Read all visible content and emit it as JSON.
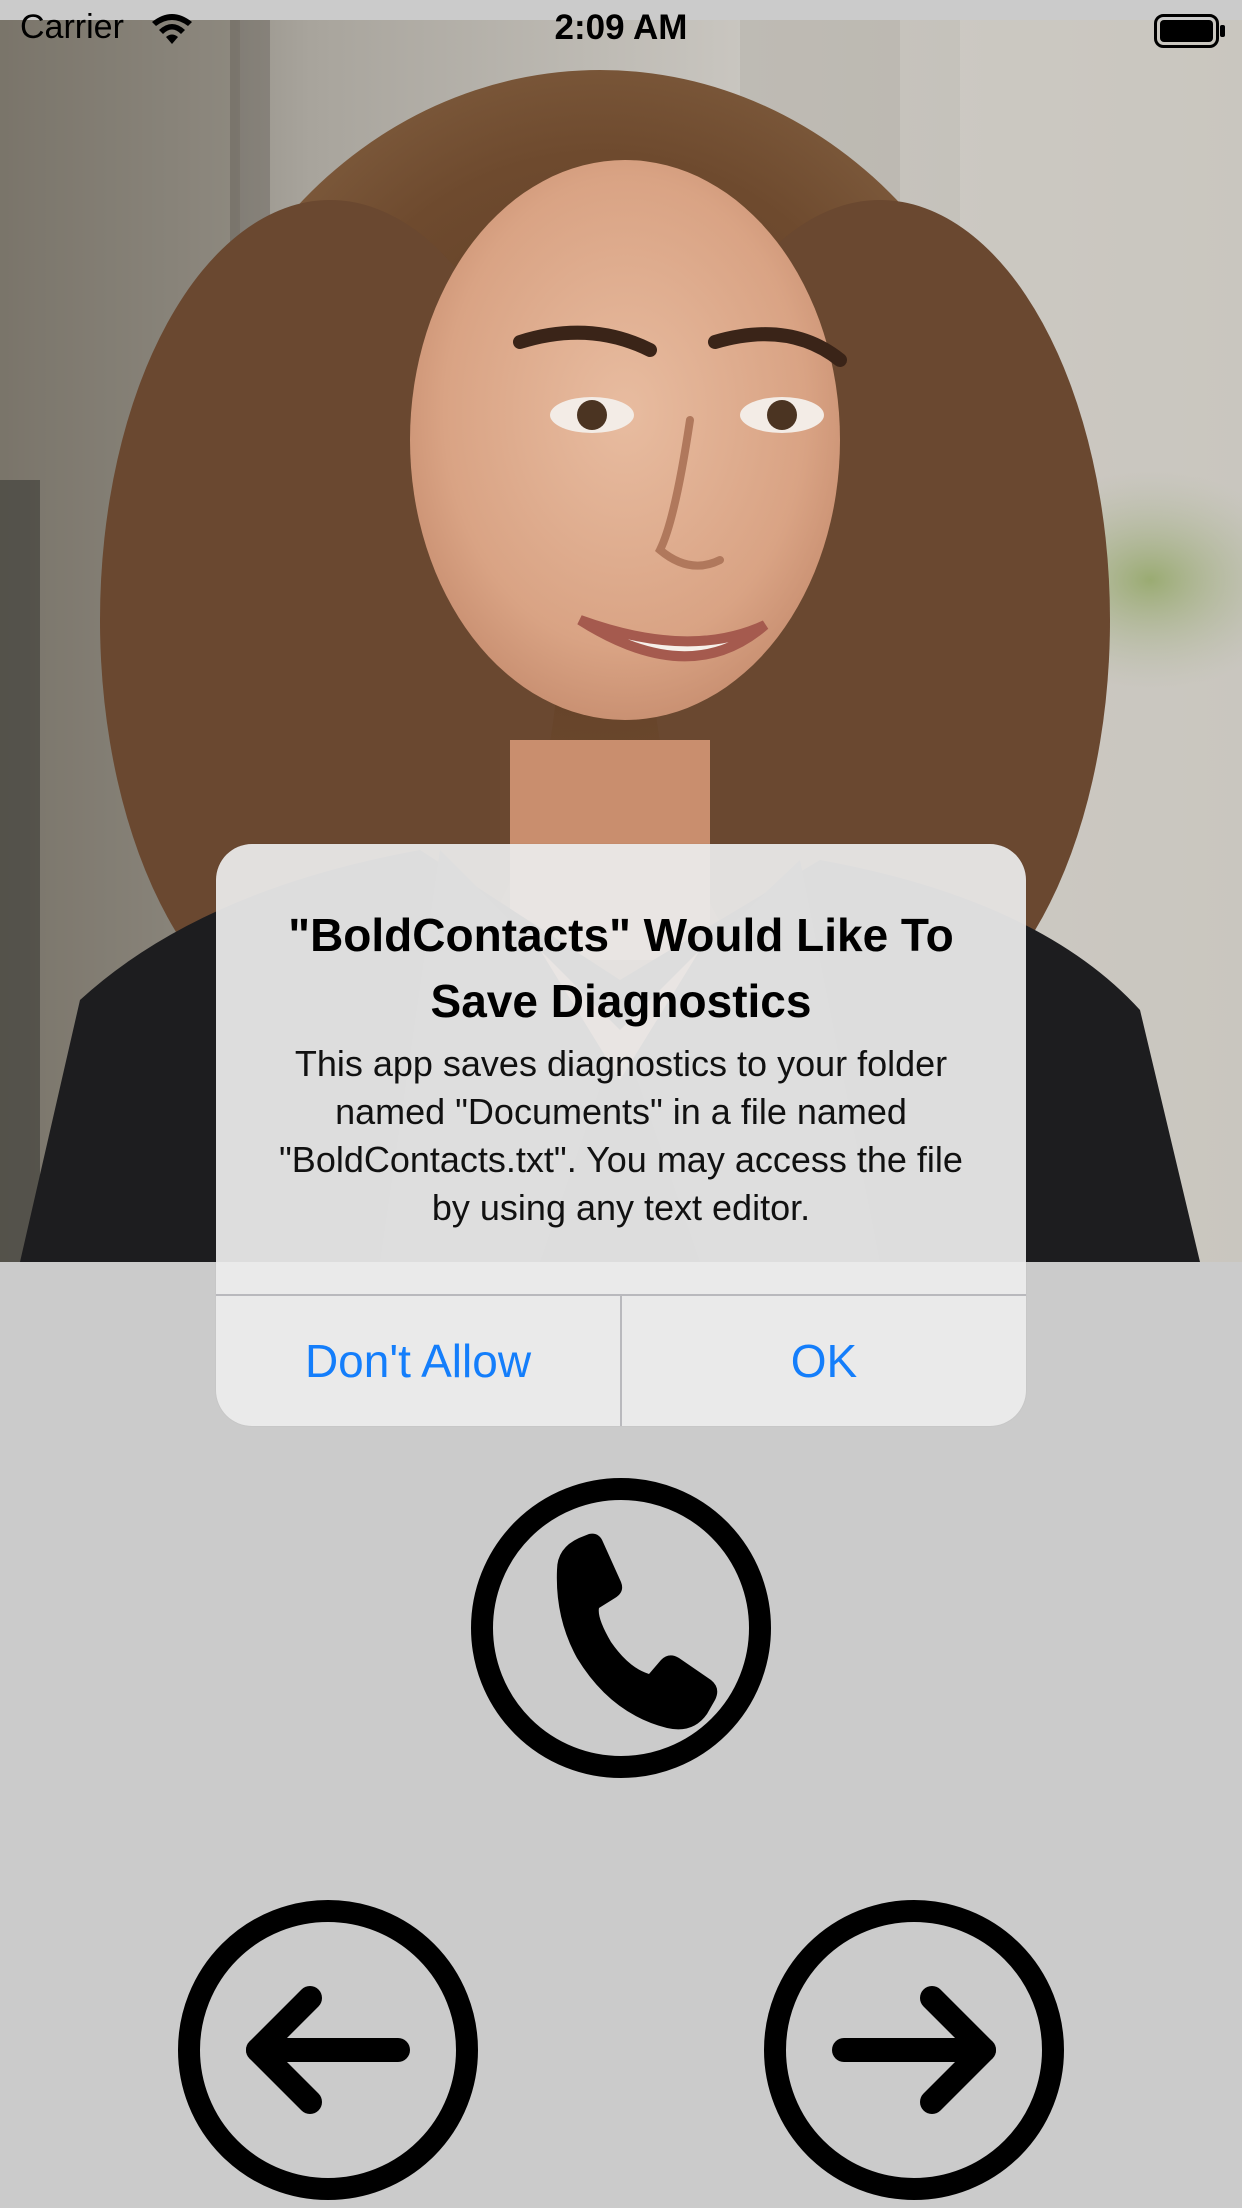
{
  "status_bar": {
    "carrier": "Carrier",
    "time": "2:09 AM",
    "wifi_icon": "wifi-icon",
    "battery_icon": "battery-full-icon"
  },
  "contact": {
    "photo": "portrait-photo"
  },
  "alert": {
    "title": "\"BoldContacts\" Would Like To Save Diagnostics",
    "message": "This app saves diagnostics to your folder named \"Documents\" in a file named \"BoldContacts.txt\". You may access the file by using any text editor.",
    "buttons": {
      "dont_allow": "Don't Allow",
      "ok": "OK"
    },
    "accent_color": "#147efb"
  },
  "controls": {
    "call_icon": "phone-icon",
    "prev_icon": "arrow-left-icon",
    "next_icon": "arrow-right-icon"
  }
}
